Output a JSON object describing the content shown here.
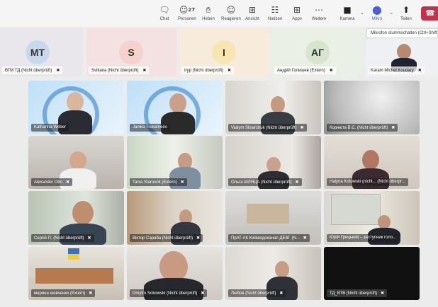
{
  "toolbar": {
    "chat": {
      "icon": "chat-icon",
      "label": "Chat"
    },
    "people": {
      "icon": "people-icon",
      "label": "Personen",
      "count": "27"
    },
    "raise": {
      "icon": "raise-hand-icon",
      "label": "Heben"
    },
    "react": {
      "icon": "react-icon",
      "label": "Reagieren"
    },
    "view": {
      "icon": "view-icon",
      "label": "Ansicht"
    },
    "notes": {
      "icon": "notes-icon",
      "label": "Notizen"
    },
    "apps": {
      "icon": "apps-icon",
      "label": "Apps"
    },
    "more": {
      "icon": "more-icon",
      "label": "Weitere"
    },
    "camera": {
      "icon": "camera-icon",
      "label": "Kamera"
    },
    "mic": {
      "icon": "microphone-icon",
      "label": "Mikro"
    },
    "share": {
      "icon": "share-icon",
      "label": "Teilen"
    },
    "end": {
      "icon": "phone-hangup-icon",
      "color": "#c4314b"
    }
  },
  "tooltip": "Mikrofon stummschalten (Ctrl+Shift+M)",
  "audience": [
    {
      "initials": "",
      "name": "ВГМ ТД (Nicht überprüft)",
      "color": "#e9e6ec"
    },
    {
      "initials": "MT",
      "name": "Svitlana (Nicht überprüft)",
      "color": "#c8d9ee"
    },
    {
      "initials": "S",
      "name": "Iryp (Nicht überprüft)",
      "color": "#f6d2cf"
    },
    {
      "initials": "I",
      "name": "Андрій Голишев (Extern)",
      "color": "#f7e6b2"
    },
    {
      "initials": "АГ",
      "name": "Karam Michel Koudary",
      "color": "#d7e5d0"
    }
  ],
  "participants": [
    {
      "name": "Katharina Weber",
      "muted": false
    },
    {
      "name": "Janika Truxamees",
      "muted": false
    },
    {
      "name": "Vadym Slisarchuk (Nicht überprüft)",
      "muted": true
    },
    {
      "name": "Корнюта В.С. (Nicht überprüft)",
      "muted": true
    },
    {
      "name": "Alexander Otto",
      "muted": true
    },
    {
      "name": "Tania Starovoit (Extern)",
      "muted": true
    },
    {
      "name": "Ольга ШЛЯЦА (Nicht überprüft)",
      "muted": true
    },
    {
      "name": "Halyna Kotowski (nicht... (Nicht überpr...",
      "muted": true
    },
    {
      "name": "Сергій П. (Nicht überprüft)",
      "muted": true
    },
    {
      "name": "Віктор Сараба (Nicht überprüft)",
      "muted": true
    },
    {
      "name": "ПрАТ АК Київводоканал ДЕВГ (N...",
      "muted": true
    },
    {
      "name": "Юрій Грицький – заступник голо...",
      "muted": true
    },
    {
      "name": "марина шевченко (Extern)",
      "muted": true
    },
    {
      "name": "Dmytro Sokowski (Nicht überprüft)",
      "muted": true
    },
    {
      "name": "Любов (Nicht überprüft)",
      "muted": true
    },
    {
      "name": "ТД_ВТВ (Nicht überprüft)",
      "muted": true
    }
  ],
  "mic_glyph": "🎙︎"
}
